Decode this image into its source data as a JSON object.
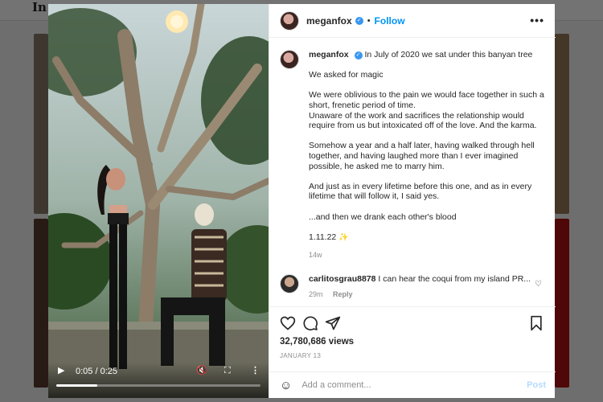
{
  "background": {
    "logo": "In"
  },
  "post": {
    "username": "meganfox",
    "follow_label": "Follow",
    "separator": "•",
    "caption_first_line": "In July of 2020 we sat under this banyan tree",
    "caption_paragraphs": [
      "We asked for magic",
      "We were oblivious to the pain we would face together in such a short, frenetic period of time.\nUnaware of the work and sacrifices the relationship would require from us but intoxicated off of the love. And the karma.",
      "Somehow a year and a half later, having walked through hell together, and having laughed more than I ever imagined possible, he asked me to marry him.",
      "And just as in every lifetime before this one, and as in every lifetime that will follow it, I said yes.",
      "...and then we drank each other's blood"
    ],
    "date_line": "1.11.22",
    "time_ago": "14w",
    "comment": {
      "username": "carlitosgrau8878",
      "text": "I can hear the coqui from my island PR...",
      "time": "29m",
      "reply_label": "Reply"
    },
    "views": "32,780,686 views",
    "date": "JANUARY 13",
    "comment_placeholder": "Add a comment...",
    "post_label": "Post"
  },
  "video": {
    "time_display": "0:05 / 0:25",
    "progress": 0.2
  },
  "colors": {
    "accent": "#0095f6",
    "verified": "#3897f0"
  }
}
